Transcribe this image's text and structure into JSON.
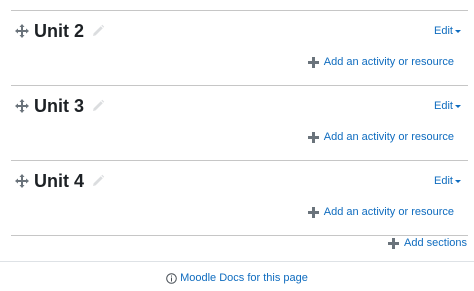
{
  "sections": [
    {
      "title": "Unit 2",
      "edit_label": "Edit",
      "add_label": "Add an activity or resource"
    },
    {
      "title": "Unit 3",
      "edit_label": "Edit",
      "add_label": "Add an activity or resource"
    },
    {
      "title": "Unit 4",
      "edit_label": "Edit",
      "add_label": "Add an activity or resource"
    }
  ],
  "add_sections_label": "Add sections",
  "footer": {
    "docs_link": "Moodle Docs for this page"
  },
  "colors": {
    "link": "#0f6cbf",
    "text": "#1d2125",
    "divider": "#c6c6c6"
  },
  "icons": [
    "move-icon",
    "pencil-icon",
    "caret-down-icon",
    "plus-icon",
    "info-icon"
  ]
}
